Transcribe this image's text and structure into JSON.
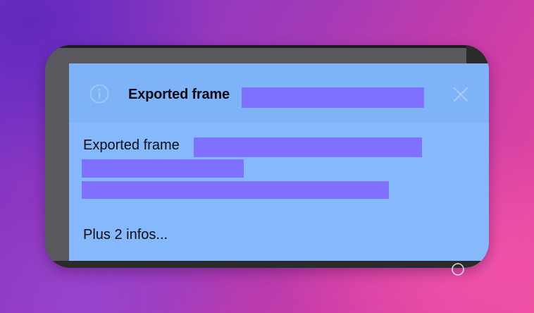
{
  "notification": {
    "title": "Exported frame",
    "body_prefix": "Exported frame",
    "more_info": "Plus 2 infos..."
  },
  "icons": {
    "info": "info-circle-icon",
    "close": "close-icon"
  },
  "colors": {
    "panel": "#86b9fb",
    "header": "#7fb3f8",
    "redaction": "#8070ff",
    "frame": "#58585d"
  }
}
